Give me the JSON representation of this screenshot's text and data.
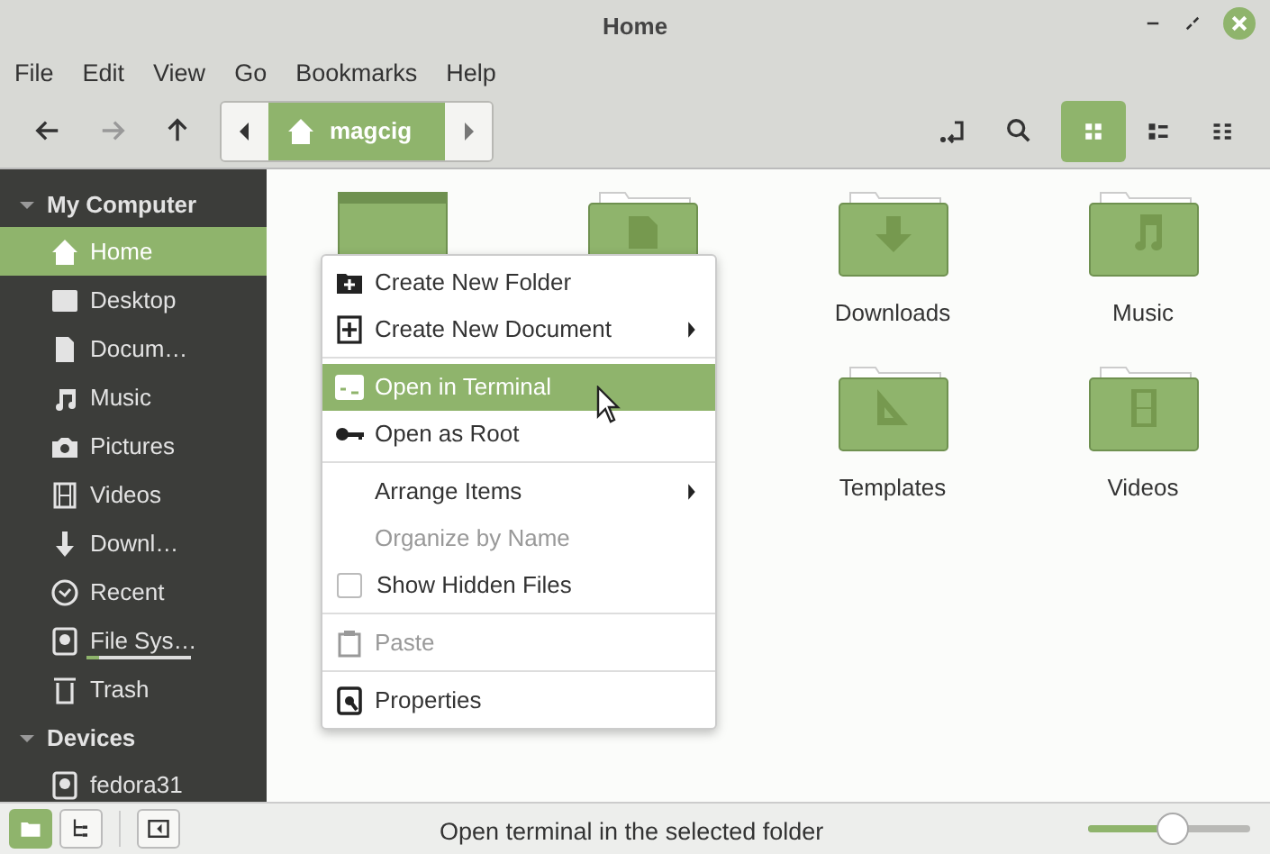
{
  "window": {
    "title": "Home"
  },
  "menubar": [
    "File",
    "Edit",
    "View",
    "Go",
    "Bookmarks",
    "Help"
  ],
  "toolbar": {
    "nav": [
      {
        "kind": "back",
        "disabled": false
      },
      {
        "kind": "forward",
        "disabled": true
      },
      {
        "kind": "up",
        "disabled": false
      }
    ],
    "path": {
      "label": "magcig"
    },
    "views": [
      {
        "kind": "grid",
        "selected": true
      },
      {
        "kind": "list",
        "selected": false
      },
      {
        "kind": "compact",
        "selected": false
      }
    ]
  },
  "sidebar": [
    {
      "heading": "My Computer",
      "expanded": true,
      "items": [
        {
          "kind": "home",
          "label": "Home",
          "selected": true
        },
        {
          "kind": "desktop",
          "label": "Desktop",
          "selected": false
        },
        {
          "kind": "document",
          "label": "Docum…",
          "selected": false
        },
        {
          "kind": "music",
          "label": "Music",
          "selected": false
        },
        {
          "kind": "camera",
          "label": "Pictures",
          "selected": false
        },
        {
          "kind": "film",
          "label": "Videos",
          "selected": false
        },
        {
          "kind": "download",
          "label": "Downl…",
          "selected": false
        },
        {
          "kind": "clock",
          "label": "Recent",
          "selected": false
        },
        {
          "kind": "drive",
          "label": "File Sys…",
          "selected": false,
          "level": 0.12
        },
        {
          "kind": "trash",
          "label": "Trash",
          "selected": false
        }
      ]
    },
    {
      "heading": "Devices",
      "expanded": true,
      "items": [
        {
          "kind": "drive",
          "label": "fedora31",
          "selected": false
        }
      ]
    }
  ],
  "folders": [
    [
      {
        "kind": "desktop"
      },
      {
        "kind": "document"
      },
      {
        "kind": "download",
        "label": "Downloads"
      },
      {
        "kind": "music",
        "label": "Music"
      }
    ],
    [
      {
        "kind": "template",
        "label": "Templates"
      },
      {
        "kind": "film",
        "label": "Videos"
      }
    ]
  ],
  "context_menu": [
    {
      "kind": "folder-plus",
      "label": "Create New Folder",
      "submenu": false,
      "selected": false,
      "disabled": false
    },
    {
      "kind": "doc-plus",
      "label": "Create New Document",
      "submenu": true,
      "selected": false,
      "disabled": false
    },
    {
      "kind": "separator"
    },
    {
      "kind": "terminal",
      "label": "Open in Terminal",
      "submenu": false,
      "selected": true,
      "disabled": false
    },
    {
      "kind": "key",
      "label": "Open as Root",
      "submenu": false,
      "selected": false,
      "disabled": false
    },
    {
      "kind": "separator"
    },
    {
      "kind": "plain",
      "label": "Arrange Items",
      "submenu": true,
      "selected": false,
      "disabled": false
    },
    {
      "kind": "plain",
      "label": "Organize by Name",
      "submenu": false,
      "selected": false,
      "disabled": true
    },
    {
      "kind": "check",
      "label": "Show Hidden Files",
      "checked": false,
      "selected": false,
      "disabled": false
    },
    {
      "kind": "separator"
    },
    {
      "kind": "clipboard",
      "label": "Paste",
      "submenu": false,
      "selected": false,
      "disabled": true
    },
    {
      "kind": "separator"
    },
    {
      "kind": "properties",
      "label": "Properties",
      "submenu": false,
      "selected": false,
      "disabled": false
    }
  ],
  "statusbar": {
    "panes": [
      {
        "kind": "places",
        "selected": true
      },
      {
        "kind": "tree",
        "selected": false
      }
    ],
    "text": "Open terminal in the selected folder",
    "zoom": {
      "level": 0.52
    }
  }
}
